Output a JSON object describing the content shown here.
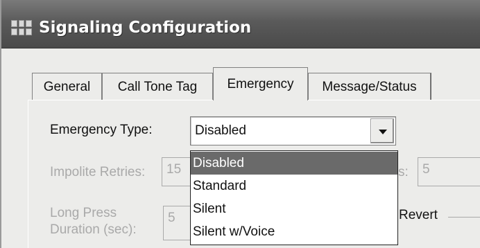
{
  "window": {
    "title": "Signaling Configuration"
  },
  "tabs": [
    {
      "label": "General",
      "active": false
    },
    {
      "label": "Call Tone Tag",
      "active": false
    },
    {
      "label": "Emergency",
      "active": true
    },
    {
      "label": "Message/Status",
      "active": false
    }
  ],
  "emergency": {
    "type_label": "Emergency Type:",
    "type_value": "Disabled",
    "options": [
      "Disabled",
      "Standard",
      "Silent",
      "Silent w/Voice"
    ],
    "selected_option": "Disabled",
    "impolite_retries_label": "Impolite Retries:",
    "impolite_retries_value": "15",
    "hidden_field_label_fragment": "s:",
    "hidden_field_value": "5",
    "long_press_label_line1": "Long Press",
    "long_press_label_line2": "Duration (sec):",
    "long_press_value": "5",
    "revert_group_label": "Revert"
  },
  "colors": {
    "titlebar": "#5a5a5a",
    "selected_option": "#6a6a6a",
    "disabled_text": "#a9a9a9"
  },
  "icons": {
    "app": "grid-app-icon",
    "dropdown": "chevron-down-icon"
  }
}
